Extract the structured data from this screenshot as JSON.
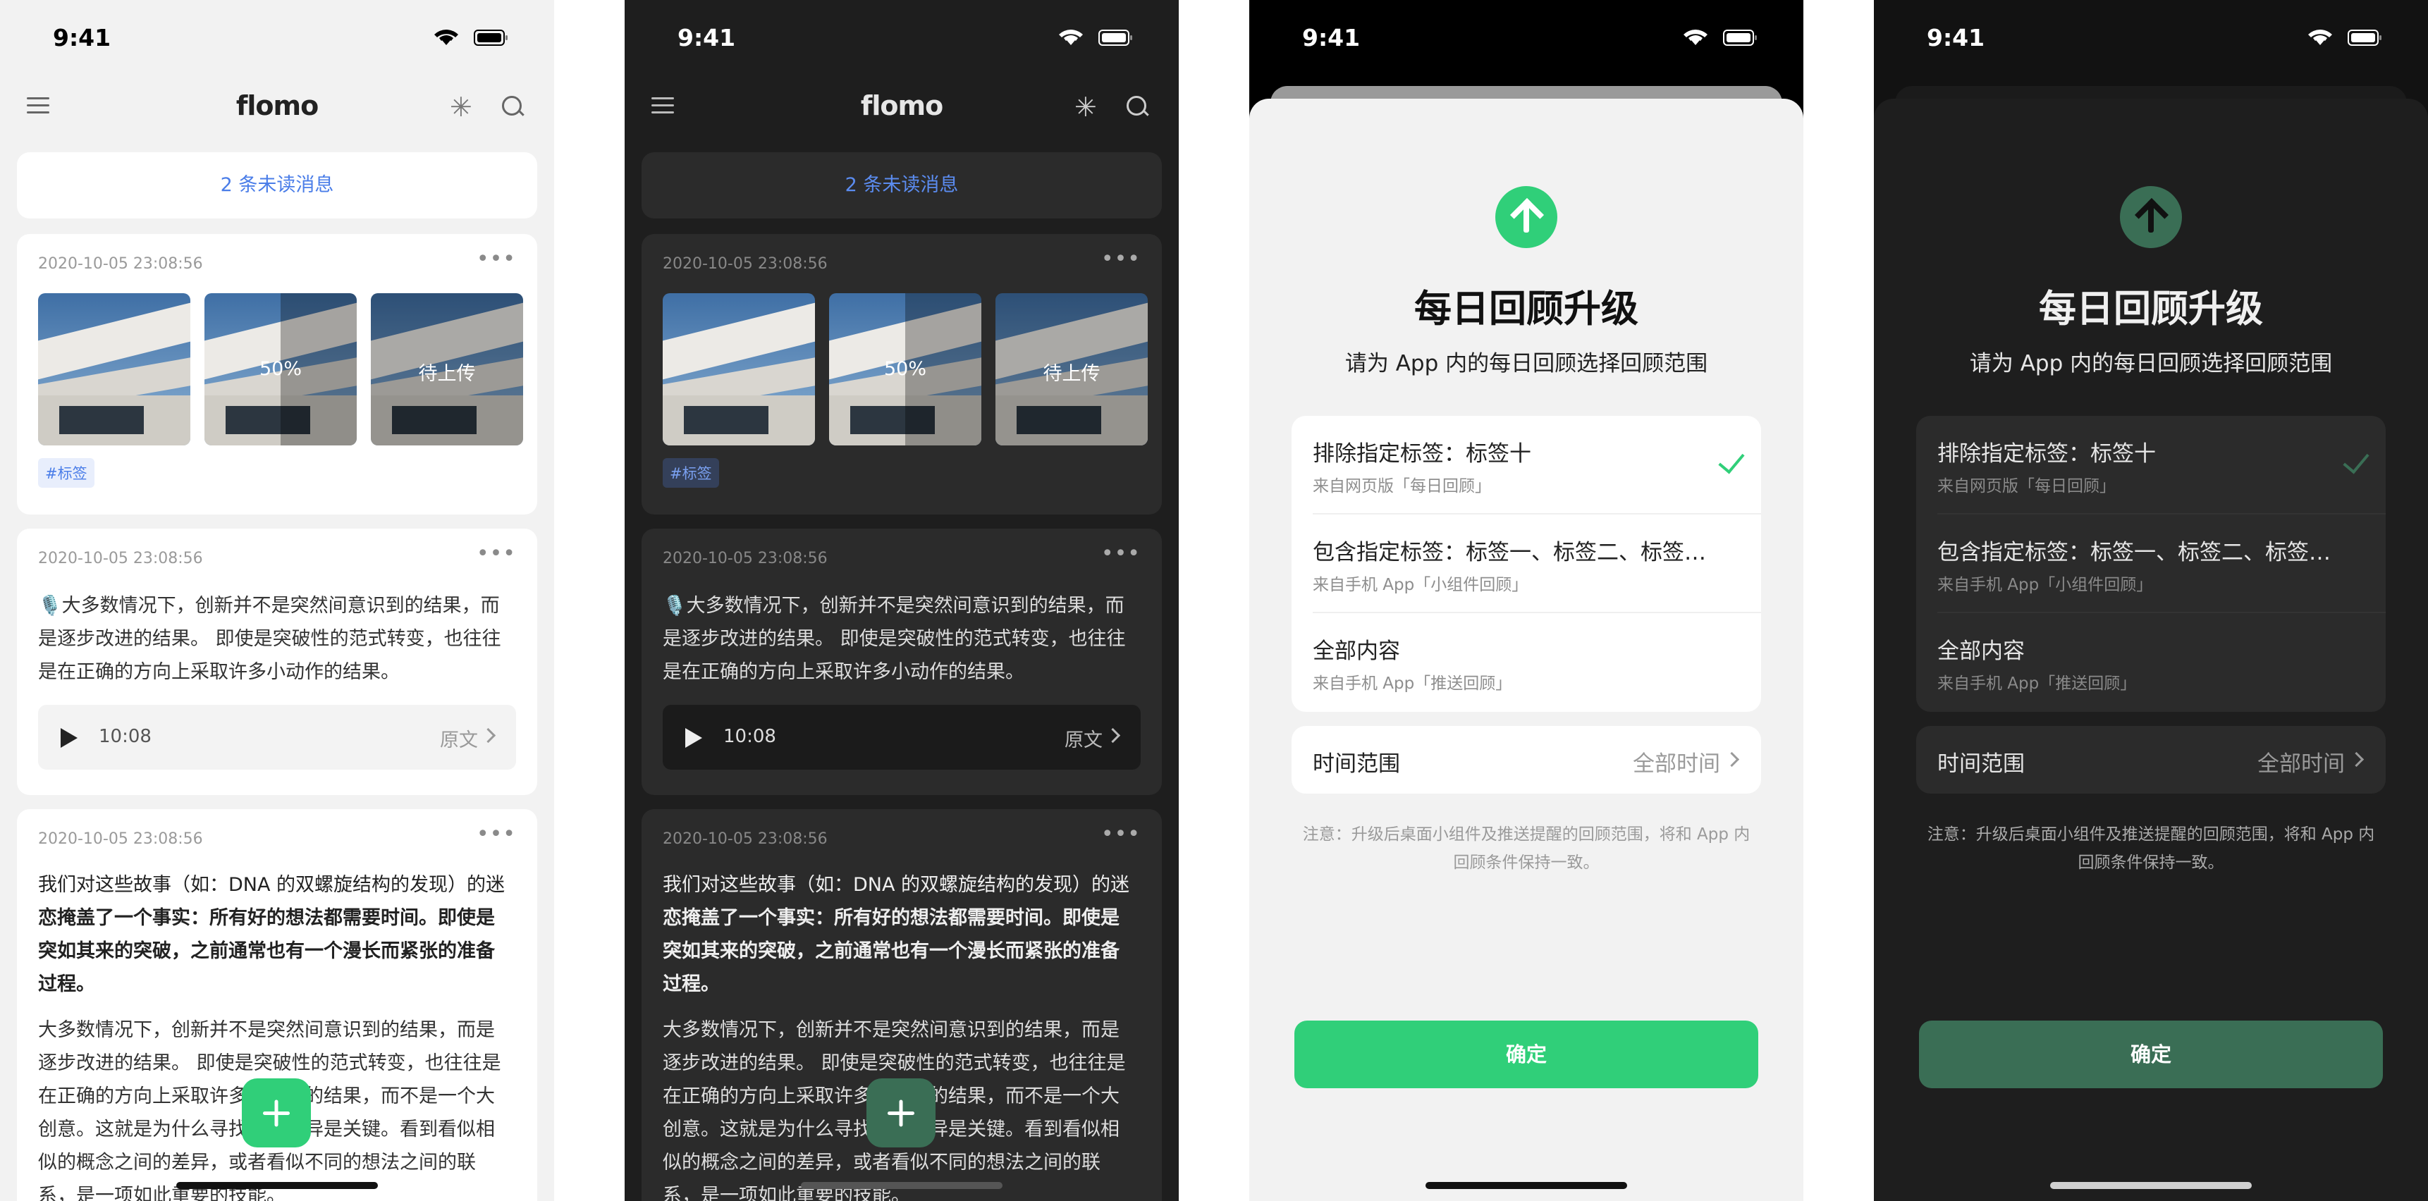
{
  "status": {
    "time": "9:41"
  },
  "header": {
    "logo": "flomo",
    "sparkle_icon": "✳"
  },
  "unread": "2 条未读消息",
  "cards": [
    {
      "date": "2020-10-05 23:08:56",
      "more": "•••",
      "images": [
        {
          "label": ""
        },
        {
          "label": "50%"
        },
        {
          "label": "待上传"
        }
      ],
      "tag": "#标签"
    },
    {
      "date": "2020-10-05 23:08:56",
      "more": "•••",
      "text_lines": [
        "🎙️大多数情况下，创新并不是突然间意识到的结果，而",
        "是逐步改进的结果。 即使是突破性的范式转变，也往往",
        "是在正确的方向上采取许多小动作的结果。"
      ],
      "audio": {
        "duration": "10:08",
        "original": "原文"
      }
    },
    {
      "date": "2020-10-05 23:08:56",
      "more": "•••",
      "text_lines": [
        "我们对这些故事（如：DNA 的双螺旋结构的发现）的迷",
        "恋掩盖了一个事实：所有好的想法都需要时间。即使是",
        "突如其来的突破，之前通常也有一个漫长而紧张的准备",
        "过程。"
      ],
      "text2_lines": [
        "大多数情况下，创新并不是突然间意识到的结果，而是",
        "逐步改进的结果。 即使是突破性的范式转变，也往往是",
        "在正确的方向上采取许多小动作的结果，而不是一个大",
        "创意。这就是为什么寻找细微差异是关键。看到看似相",
        "似的概念之间的差异，或者看似不同的想法之间的联",
        "系，是一项如此重要的技能。"
      ]
    }
  ],
  "modal": {
    "title": "每日回顾升级",
    "subtitle": "请为 App 内的每日回顾选择回顾范围",
    "options": [
      {
        "title": "排除指定标签：标签十",
        "source": "来自网页版「每日回顾」",
        "checked": true
      },
      {
        "title": "包含指定标签：标签一、标签二、标签…",
        "source": "来自手机 App「小组件回顾」",
        "checked": false
      },
      {
        "title": "全部内容",
        "source": "来自手机 App「推送回顾」",
        "checked": false
      }
    ],
    "range_label": "时间范围",
    "range_value": "全部时间",
    "note_line1": "注意：升级后桌面小组件及推送提醒的回顾范围，将和 App 内",
    "note_line2": "回顾条件保持一致。",
    "confirm": "确定"
  },
  "colors": {
    "accent_green": "#30cf79",
    "dark_green": "#3a6e55",
    "link_blue": "#4a7de8"
  }
}
